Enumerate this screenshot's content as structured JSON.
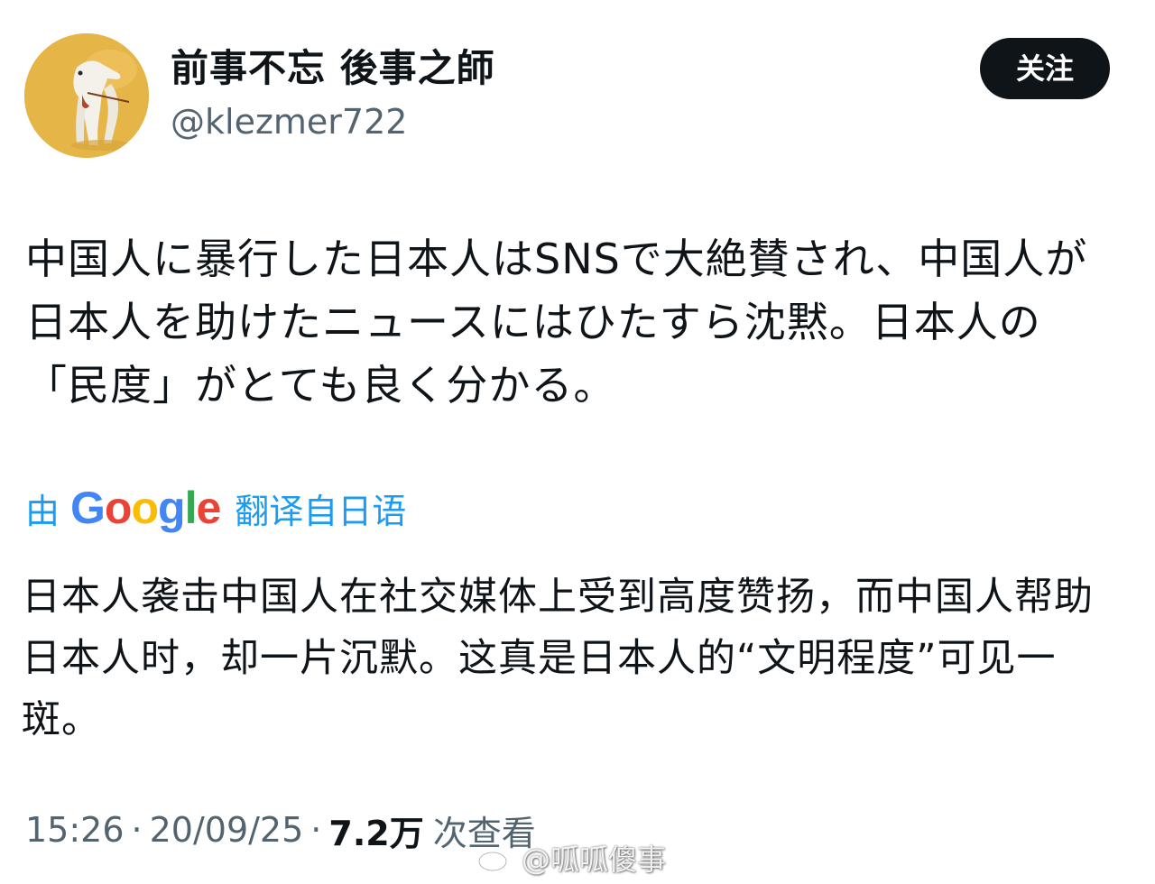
{
  "author": {
    "display_name": "前事不忘 後事之師",
    "handle": "@klezmer722",
    "avatar_icon": "dog-avatar",
    "avatar_bg": "#e7b64a"
  },
  "follow_button": {
    "label": "关注"
  },
  "tweet": {
    "text": "中国人に暴行した日本人はSNSで大絶賛され、中国人が日本人を助けたニュースにはひたすら沈黙。日本人の「民度」がとても良く分かる。"
  },
  "translation": {
    "prefix": "由",
    "provider": "Google",
    "suffix": "翻译自日语",
    "text": "日本人袭击中国人在社交媒体上受到高度赞扬，而中国人帮助日本人时，却一片沉默。这真是日本人的“文明程度”可见一斑。",
    "link_color": "#1d9bf0"
  },
  "meta": {
    "time": "15:26",
    "separator": "·",
    "date": "20/09/25",
    "views_count": "7.2万",
    "views_label": "次查看"
  },
  "watermark": {
    "icon": "weibo-icon",
    "text": "@呱呱傻事"
  }
}
